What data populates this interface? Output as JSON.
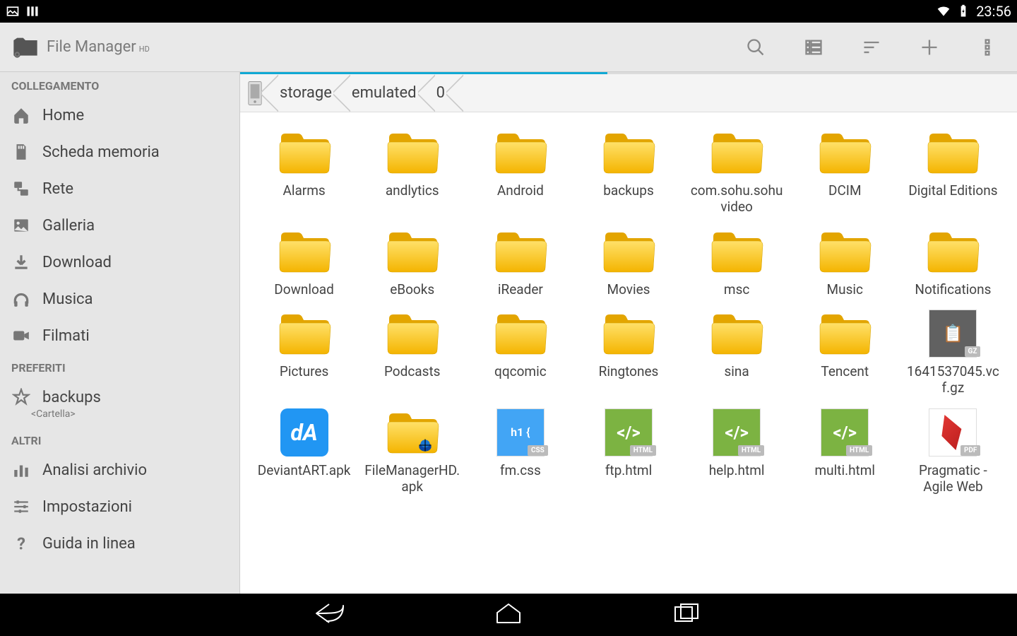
{
  "status": {
    "time": "23:56"
  },
  "app": {
    "title": "File Manager",
    "superscript": "HD"
  },
  "sidebar": {
    "sections": [
      {
        "header": "COLLEGAMENTO",
        "items": [
          {
            "name": "home",
            "label": "Home",
            "icon": "home"
          },
          {
            "name": "sdcard",
            "label": "Scheda memoria",
            "icon": "sdcard"
          },
          {
            "name": "network",
            "label": "Rete",
            "icon": "network"
          },
          {
            "name": "gallery",
            "label": "Galleria",
            "icon": "image"
          },
          {
            "name": "download",
            "label": "Download",
            "icon": "download"
          },
          {
            "name": "music",
            "label": "Musica",
            "icon": "headphones"
          },
          {
            "name": "videos",
            "label": "Filmati",
            "icon": "video"
          }
        ]
      },
      {
        "header": "PREFERITI",
        "items": [
          {
            "name": "fav-backups",
            "label": "backups",
            "sub": "<Cartella>",
            "icon": "star"
          }
        ]
      },
      {
        "header": "ALTRI",
        "items": [
          {
            "name": "analysis",
            "label": "Analisi archivio",
            "icon": "chart"
          },
          {
            "name": "settings",
            "label": "Impostazioni",
            "icon": "sliders"
          },
          {
            "name": "help",
            "label": "Guida in linea",
            "icon": "help"
          }
        ]
      }
    ]
  },
  "breadcrumb": [
    "storage",
    "emulated",
    "0"
  ],
  "files": [
    {
      "name": "Alarms",
      "type": "folder"
    },
    {
      "name": "andlytics",
      "type": "folder"
    },
    {
      "name": "Android",
      "type": "folder"
    },
    {
      "name": "backups",
      "type": "folder"
    },
    {
      "name": "com.sohu.sohuvideo",
      "type": "folder"
    },
    {
      "name": "DCIM",
      "type": "folder"
    },
    {
      "name": "Digital Editions",
      "type": "folder"
    },
    {
      "name": "Download",
      "type": "folder"
    },
    {
      "name": "eBooks",
      "type": "folder"
    },
    {
      "name": "iReader",
      "type": "folder"
    },
    {
      "name": "Movies",
      "type": "folder"
    },
    {
      "name": "msc",
      "type": "folder"
    },
    {
      "name": "Music",
      "type": "folder"
    },
    {
      "name": "Notifications",
      "type": "folder"
    },
    {
      "name": "Pictures",
      "type": "folder"
    },
    {
      "name": "Podcasts",
      "type": "folder"
    },
    {
      "name": "qqcomic",
      "type": "folder"
    },
    {
      "name": "Ringtones",
      "type": "folder"
    },
    {
      "name": "sina",
      "type": "folder"
    },
    {
      "name": "Tencent",
      "type": "folder"
    },
    {
      "name": "1641537045.vcf.gz",
      "type": "gz"
    },
    {
      "name": "DeviantART.apk",
      "type": "apk-da"
    },
    {
      "name": "FileManagerHD.apk",
      "type": "apk-fm"
    },
    {
      "name": "fm.css",
      "type": "css"
    },
    {
      "name": "ftp.html",
      "type": "html"
    },
    {
      "name": "help.html",
      "type": "html"
    },
    {
      "name": "multi.html",
      "type": "html"
    },
    {
      "name": "Pragmatic - Agile Web",
      "type": "pdf"
    }
  ]
}
